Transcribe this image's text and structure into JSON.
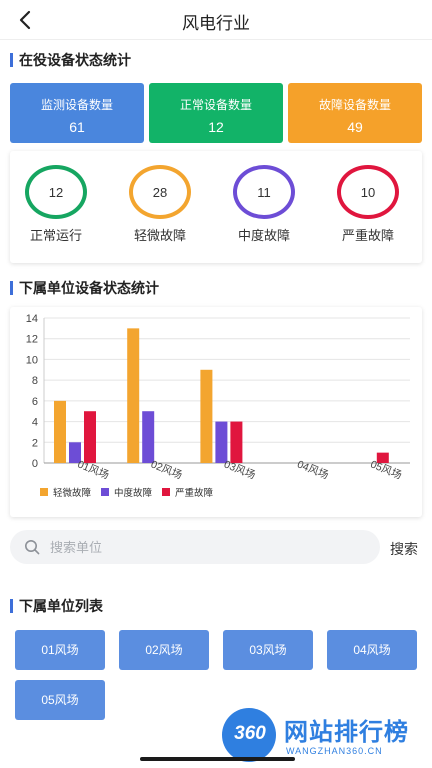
{
  "header": {
    "title": "风电行业"
  },
  "sections": {
    "status_title": "在役设备状态统计",
    "sub_status_title": "下属单位设备状态统计",
    "unit_list_title": "下属单位列表"
  },
  "summary_cards": [
    {
      "label": "监测设备数量",
      "value": "61",
      "color": "#4a86dd"
    },
    {
      "label": "正常设备数量",
      "value": "12",
      "color": "#12b368"
    },
    {
      "label": "故障设备数量",
      "value": "49",
      "color": "#f5a12a"
    }
  ],
  "rings": [
    {
      "value": "12",
      "label": "正常运行",
      "color": "#16a661"
    },
    {
      "value": "28",
      "label": "轻微故障",
      "color": "#f3a52f"
    },
    {
      "value": "11",
      "label": "中度故障",
      "color": "#6d4dd6"
    },
    {
      "value": "10",
      "label": "严重故障",
      "color": "#e0163e"
    }
  ],
  "chart_data": {
    "type": "bar",
    "categories": [
      "01风场",
      "02风场",
      "03风场",
      "04风场",
      "05风场"
    ],
    "series": [
      {
        "name": "轻微故障",
        "values": [
          6,
          13,
          9,
          0,
          0
        ],
        "color": "#f3a52f"
      },
      {
        "name": "中度故障",
        "values": [
          2,
          5,
          4,
          0,
          0
        ],
        "color": "#6d4dd6"
      },
      {
        "name": "严重故障",
        "values": [
          5,
          0,
          4,
          0,
          1
        ],
        "color": "#e0163e"
      }
    ],
    "yticks": [
      "0",
      "2",
      "4",
      "6",
      "8",
      "10",
      "12",
      "14"
    ],
    "ylim": [
      0,
      14
    ],
    "legend_position": "bottom-left",
    "grid": true
  },
  "search": {
    "placeholder": "搜索单位",
    "button": "搜索"
  },
  "units": [
    "01风场",
    "02风场",
    "03风场",
    "04风场",
    "05风场"
  ],
  "watermark": {
    "logo": "360",
    "text": "网站排行榜",
    "sub": "WANGZHAN360.CN"
  }
}
